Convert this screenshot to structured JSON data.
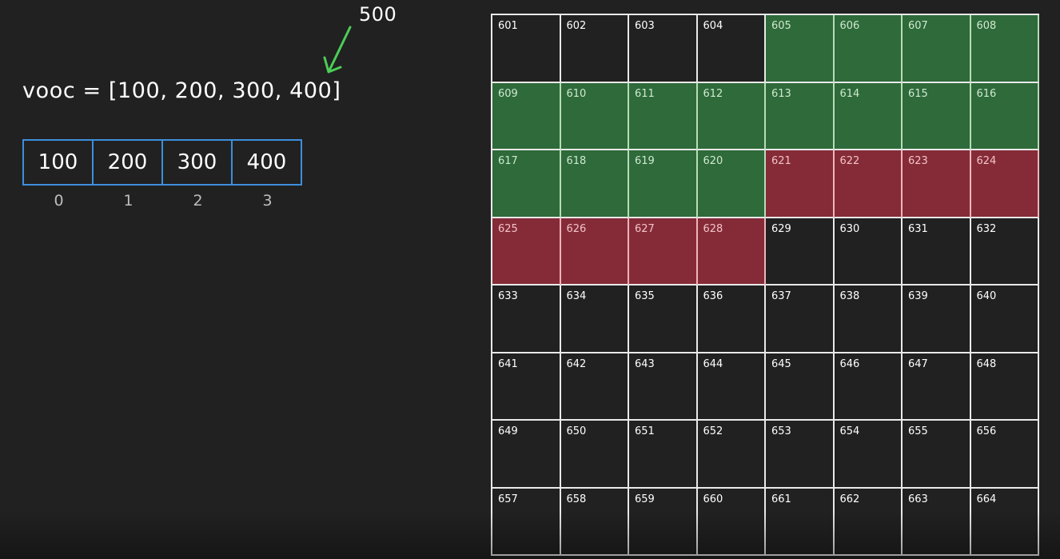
{
  "annotation": {
    "new_value": "500",
    "arrow_color": "#4ccd57"
  },
  "code": {
    "line": "vooc = [100, 200, 300, 400]"
  },
  "array": {
    "cells": [
      "100",
      "200",
      "300",
      "400"
    ],
    "indices": [
      "0",
      "1",
      "2",
      "3"
    ],
    "border_color": "#3d8fdc"
  },
  "memory": {
    "colors": {
      "green": "#2e6a3a",
      "red": "#852b37",
      "plain": "#212121"
    },
    "cells": [
      {
        "label": "601",
        "state": "plain"
      },
      {
        "label": "602",
        "state": "plain"
      },
      {
        "label": "603",
        "state": "plain"
      },
      {
        "label": "604",
        "state": "plain"
      },
      {
        "label": "605",
        "state": "green"
      },
      {
        "label": "606",
        "state": "green"
      },
      {
        "label": "607",
        "state": "green"
      },
      {
        "label": "608",
        "state": "green"
      },
      {
        "label": "609",
        "state": "green"
      },
      {
        "label": "610",
        "state": "green"
      },
      {
        "label": "611",
        "state": "green"
      },
      {
        "label": "612",
        "state": "green"
      },
      {
        "label": "613",
        "state": "green"
      },
      {
        "label": "614",
        "state": "green"
      },
      {
        "label": "615",
        "state": "green"
      },
      {
        "label": "616",
        "state": "green"
      },
      {
        "label": "617",
        "state": "green"
      },
      {
        "label": "618",
        "state": "green"
      },
      {
        "label": "619",
        "state": "green"
      },
      {
        "label": "620",
        "state": "green"
      },
      {
        "label": "621",
        "state": "red"
      },
      {
        "label": "622",
        "state": "red"
      },
      {
        "label": "623",
        "state": "red"
      },
      {
        "label": "624",
        "state": "red"
      },
      {
        "label": "625",
        "state": "red"
      },
      {
        "label": "626",
        "state": "red"
      },
      {
        "label": "627",
        "state": "red"
      },
      {
        "label": "628",
        "state": "red"
      },
      {
        "label": "629",
        "state": "plain"
      },
      {
        "label": "630",
        "state": "plain"
      },
      {
        "label": "631",
        "state": "plain"
      },
      {
        "label": "632",
        "state": "plain"
      },
      {
        "label": "633",
        "state": "plain"
      },
      {
        "label": "634",
        "state": "plain"
      },
      {
        "label": "635",
        "state": "plain"
      },
      {
        "label": "636",
        "state": "plain"
      },
      {
        "label": "637",
        "state": "plain"
      },
      {
        "label": "638",
        "state": "plain"
      },
      {
        "label": "639",
        "state": "plain"
      },
      {
        "label": "640",
        "state": "plain"
      },
      {
        "label": "641",
        "state": "plain"
      },
      {
        "label": "642",
        "state": "plain"
      },
      {
        "label": "643",
        "state": "plain"
      },
      {
        "label": "644",
        "state": "plain"
      },
      {
        "label": "645",
        "state": "plain"
      },
      {
        "label": "646",
        "state": "plain"
      },
      {
        "label": "647",
        "state": "plain"
      },
      {
        "label": "648",
        "state": "plain"
      },
      {
        "label": "649",
        "state": "plain"
      },
      {
        "label": "650",
        "state": "plain"
      },
      {
        "label": "651",
        "state": "plain"
      },
      {
        "label": "652",
        "state": "plain"
      },
      {
        "label": "653",
        "state": "plain"
      },
      {
        "label": "654",
        "state": "plain"
      },
      {
        "label": "655",
        "state": "plain"
      },
      {
        "label": "656",
        "state": "plain"
      },
      {
        "label": "657",
        "state": "plain"
      },
      {
        "label": "658",
        "state": "plain"
      },
      {
        "label": "659",
        "state": "plain"
      },
      {
        "label": "660",
        "state": "plain"
      },
      {
        "label": "661",
        "state": "plain"
      },
      {
        "label": "662",
        "state": "plain"
      },
      {
        "label": "663",
        "state": "plain"
      },
      {
        "label": "664",
        "state": "plain"
      }
    ]
  }
}
